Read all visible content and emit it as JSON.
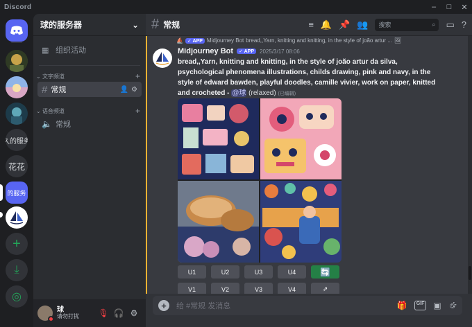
{
  "window": {
    "app_name": "Discord",
    "minimize": "–",
    "maximize": "□",
    "close": "✕"
  },
  "servers": [
    {
      "name": "home",
      "label": ""
    },
    {
      "name": "server-1",
      "label": ""
    },
    {
      "name": "server-2",
      "label": ""
    },
    {
      "name": "server-3",
      "label": ""
    },
    {
      "name": "server-4",
      "label": "久的服务"
    },
    {
      "name": "server-5",
      "label": "花花"
    },
    {
      "name": "server-6",
      "label": "的服务"
    },
    {
      "name": "midjourney",
      "label": ""
    }
  ],
  "rail_actions": {
    "add_server": "+",
    "download": "⤓",
    "discover": "◎"
  },
  "sidebar": {
    "server_name": "球的服务器",
    "events_label": "组织活动",
    "categories": [
      {
        "label": "文字频道",
        "channels": [
          {
            "label": "常规",
            "selected": true
          }
        ]
      },
      {
        "label": "语音频道",
        "channels": [
          {
            "label": "常规",
            "selected": false
          }
        ]
      }
    ]
  },
  "user": {
    "name": "球",
    "status": "请勿打扰"
  },
  "channel_header": {
    "name": "常规",
    "search_placeholder": "搜索"
  },
  "message": {
    "reply_app_badge": "✓ APP",
    "reply_author": "Midjourney Bot",
    "reply_preview": "bread,,Yarn, knitting and knitting, in the style of joão artur ...",
    "author": "Midjourney Bot",
    "app_badge": "✓ APP",
    "timestamp": "2025/3/17 08:06",
    "prompt": "bread,,Yarn, knitting and knitting, in the style of joão artur da silva, psychological phenomena illustrations, childs drawing, pink and navy, in the style of edward bawden, playful doodles, camille vivier, work on paper, knitted and crocheted",
    "prompt_suffix": " - ",
    "mention": "@球",
    "mode": " (relaxed)",
    "edited": "(已编辑)"
  },
  "buttons": {
    "upscale": [
      "U1",
      "U2",
      "U3",
      "U4"
    ],
    "variation": [
      "V1",
      "V2",
      "V3",
      "V4"
    ],
    "reroll_icon": "refresh-icon",
    "open_icon": "external-link-icon"
  },
  "composer": {
    "placeholder": "给 #常规 发消息",
    "gif_label": "GIF"
  },
  "colors": {
    "accent": "#5865f2",
    "green": "#248046",
    "highlight": "#f0b232",
    "dnd": "#f23f43"
  }
}
